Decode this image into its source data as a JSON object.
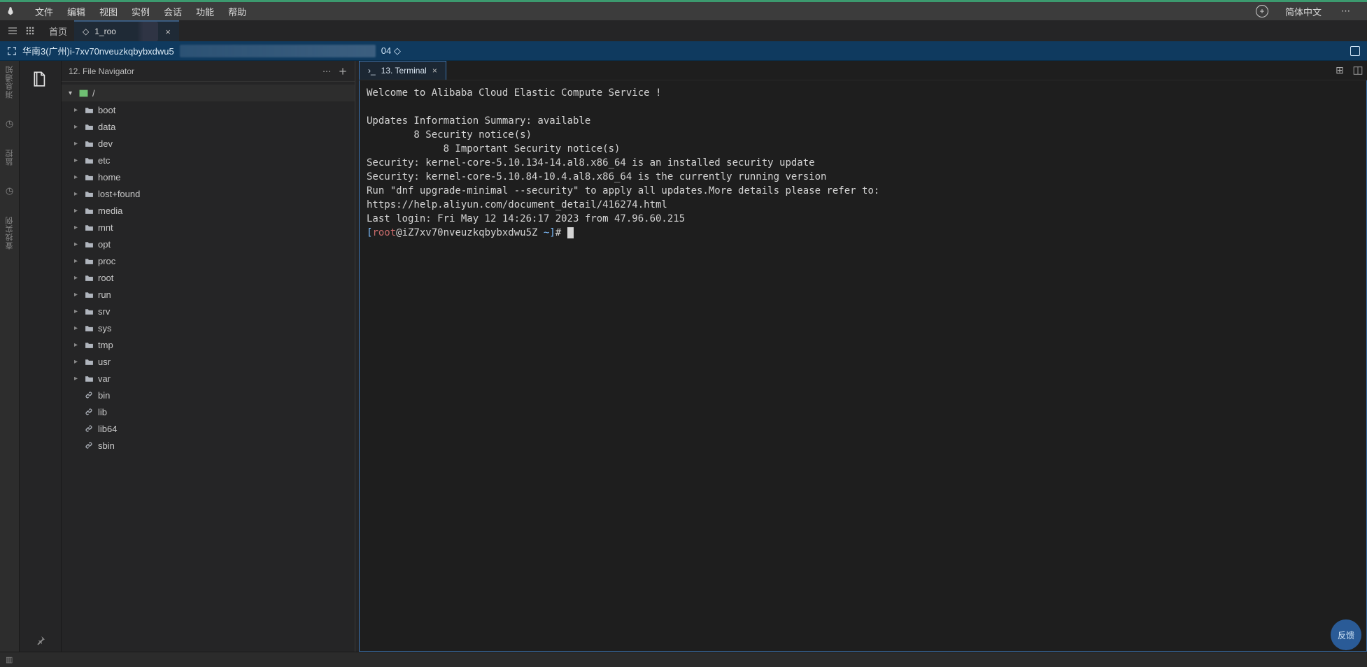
{
  "top_edge_color": "#3c9a6f",
  "menubar": {
    "items": [
      "文件",
      "编辑",
      "视图",
      "实例",
      "会话",
      "功能",
      "帮助"
    ],
    "language": "简体中文"
  },
  "tabsbar": {
    "home_label": "首页",
    "tab_label": "1_roo",
    "tab_full_hidden": "•••"
  },
  "connbar": {
    "prefix_icon": "fullscreen-icon",
    "text": "华南3(广州)i-7xv70nveuzkqbybxdwu5",
    "suffix": "04  ◇"
  },
  "buddy": {
    "labels": [
      "消息通知",
      "监控",
      "查找实例"
    ],
    "time_icon": "clock"
  },
  "filenav": {
    "title": "12. File Navigator",
    "root_name": "/",
    "items": [
      {
        "name": "boot",
        "type": "folder"
      },
      {
        "name": "data",
        "type": "folder"
      },
      {
        "name": "dev",
        "type": "folder"
      },
      {
        "name": "etc",
        "type": "folder"
      },
      {
        "name": "home",
        "type": "folder"
      },
      {
        "name": "lost+found",
        "type": "folder"
      },
      {
        "name": "media",
        "type": "folder"
      },
      {
        "name": "mnt",
        "type": "folder"
      },
      {
        "name": "opt",
        "type": "folder"
      },
      {
        "name": "proc",
        "type": "folder"
      },
      {
        "name": "root",
        "type": "folder"
      },
      {
        "name": "run",
        "type": "folder"
      },
      {
        "name": "srv",
        "type": "folder"
      },
      {
        "name": "sys",
        "type": "folder"
      },
      {
        "name": "tmp",
        "type": "folder"
      },
      {
        "name": "usr",
        "type": "folder"
      },
      {
        "name": "var",
        "type": "folder"
      },
      {
        "name": "bin",
        "type": "link"
      },
      {
        "name": "lib",
        "type": "link"
      },
      {
        "name": "lib64",
        "type": "link"
      },
      {
        "name": "sbin",
        "type": "link"
      }
    ]
  },
  "terminal_tab": {
    "label": "13. Terminal"
  },
  "terminal": {
    "lines": [
      "Welcome to Alibaba Cloud Elastic Compute Service !",
      "",
      "Updates Information Summary: available",
      "        8 Security notice(s)",
      "             8 Important Security notice(s)",
      "Security: kernel-core-5.10.134-14.al8.x86_64 is an installed security update",
      "Security: kernel-core-5.10.84-10.4.al8.x86_64 is the currently running version",
      "Run \"dnf upgrade-minimal --security\" to apply all updates.More details please refer to:",
      "https://help.aliyun.com/document_detail/416274.html",
      "Last login: Fri May 12 14:26:17 2023 from 47.96.60.215"
    ],
    "prompt": {
      "lb": "[",
      "user": "root",
      "at": "@",
      "host": "iZ7xv70nveuzkqbybxdwu5Z ",
      "path": "~",
      "rb": "]",
      "hash": "# "
    }
  },
  "feedback_label": "反馈"
}
